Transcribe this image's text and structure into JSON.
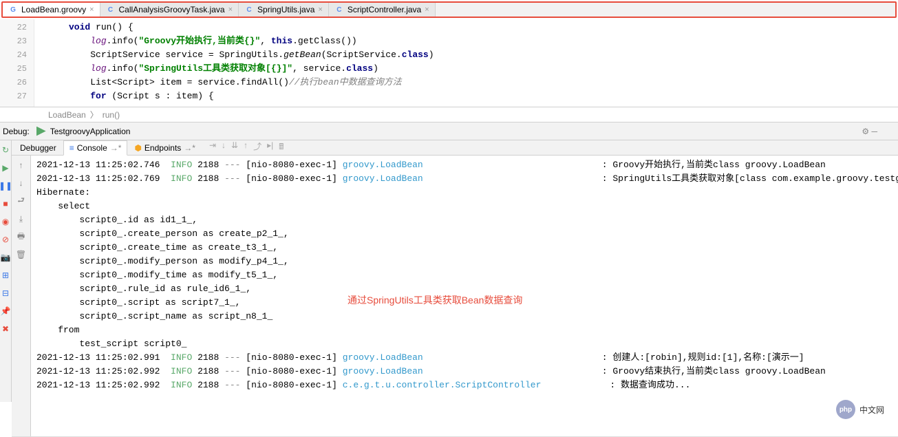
{
  "tabs": [
    {
      "name": "LoadBean.groovy",
      "icon": "G",
      "active": true
    },
    {
      "name": "CallAnalysisGroovyTask.java",
      "icon": "C",
      "active": false
    },
    {
      "name": "SpringUtils.java",
      "icon": "C",
      "active": false
    },
    {
      "name": "ScriptController.java",
      "icon": "C",
      "active": false
    }
  ],
  "editor": {
    "lines": [
      "22",
      "23",
      "24",
      "25",
      "26",
      "27"
    ],
    "code": {
      "l22": {
        "kw1": "void",
        "name": " run() {"
      },
      "l23": {
        "field": "log",
        "m": ".info(",
        "str": "\"Groovy开始执行,当前类{}\"",
        "rest": ", ",
        "kw": "this",
        "rest2": ".getClass())"
      },
      "l24": {
        "t": "ScriptService service = SpringUtils.",
        "static": "getBean",
        "rest": "(ScriptService.",
        "kw": "class",
        "rest2": ")"
      },
      "l25": {
        "field": "log",
        "m": ".info(",
        "str": "\"SpringUtils工具类获取对象[{}]\"",
        "rest": ", service.",
        "kw": "class",
        "rest2": ")"
      },
      "l26": {
        "t": "List<Script> item = service.findAll()",
        "comment": "//执行bean中数据查询方法"
      },
      "l27": {
        "kw": "for",
        "rest": " (Script s : item) {"
      }
    }
  },
  "breadcrumb": {
    "a": "LoadBean",
    "sep": "〉",
    "b": "run()"
  },
  "debug": {
    "label": "Debug:",
    "config": "TestgroovyApplication",
    "tabs": {
      "debugger": "Debugger",
      "console": "Console",
      "endpoints": "Endpoints"
    },
    "pins": {
      "console": "→*",
      "endpoints": "→*"
    }
  },
  "console": {
    "lines": [
      {
        "ts": "2021-12-13 11:25:02.746  ",
        "lvl": "INFO",
        "pid": " 2188 ",
        "sep": "---",
        "thread": " [nio-8080-exec-1] ",
        "logger": "groovy.LoadBean",
        "colon": ": ",
        "msg": "Groovy开始执行,当前类class groovy.LoadBean"
      },
      {
        "ts": "2021-12-13 11:25:02.769  ",
        "lvl": "INFO",
        "pid": " 2188 ",
        "sep": "---",
        "thread": " [nio-8080-exec-1] ",
        "logger": "groovy.LoadBean",
        "colon": ": ",
        "msg": "SpringUtils工具类获取对象[class com.example.groovy.testg"
      }
    ],
    "sql": [
      "Hibernate: ",
      "    select",
      "        script0_.id as id1_1_,",
      "        script0_.create_person as create_p2_1_,",
      "        script0_.create_time as create_t3_1_,",
      "        script0_.modify_person as modify_p4_1_,",
      "        script0_.modify_time as modify_t5_1_,",
      "        script0_.rule_id as rule_id6_1_,",
      "        script0_.script as script7_1_,",
      "        script0_.script_name as script_n8_1_ ",
      "    from",
      "        test_script script0_"
    ],
    "lines2": [
      {
        "ts": "2021-12-13 11:25:02.991  ",
        "lvl": "INFO",
        "pid": " 2188 ",
        "sep": "---",
        "thread": " [nio-8080-exec-1] ",
        "logger": "groovy.LoadBean",
        "colon": ": ",
        "msg": "创建人:[robin],规则id:[1],名称:[演示一]"
      },
      {
        "ts": "2021-12-13 11:25:02.992  ",
        "lvl": "INFO",
        "pid": " 2188 ",
        "sep": "---",
        "thread": " [nio-8080-exec-1] ",
        "logger": "groovy.LoadBean",
        "colon": ": ",
        "msg": "Groovy结束执行,当前类class groovy.LoadBean"
      },
      {
        "ts": "2021-12-13 11:25:02.992  ",
        "lvl": "INFO",
        "pid": " 2188 ",
        "sep": "---",
        "thread": " [nio-8080-exec-1] ",
        "logger": "c.e.g.t.u.controller.ScriptController",
        "colon": ": ",
        "msg": "数据查询成功..."
      }
    ]
  },
  "annotation": "通过SpringUtils工具类获取Bean数据查询",
  "watermark": {
    "logo": "php",
    "text": "中文网"
  }
}
